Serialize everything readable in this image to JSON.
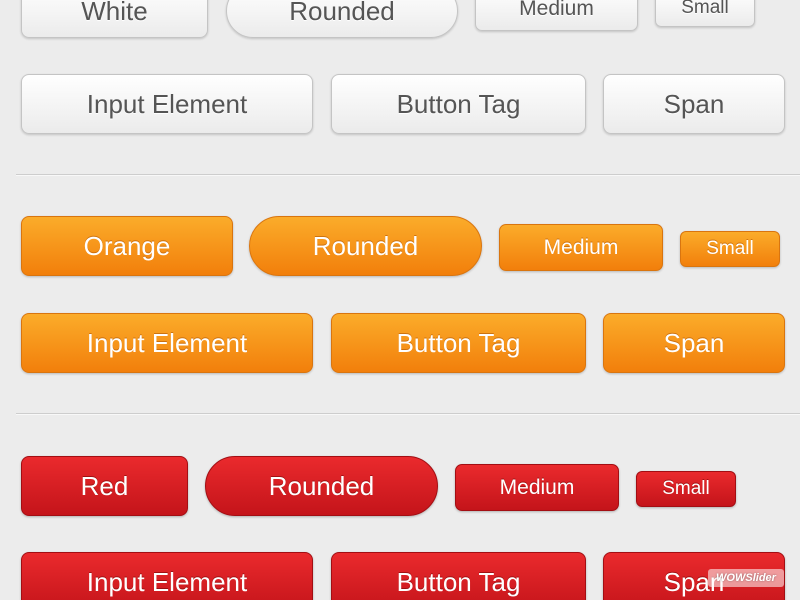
{
  "white_section": {
    "row1": [
      "White",
      "Rounded",
      "Medium",
      "Small"
    ],
    "row2": [
      "Input Element",
      "Button Tag",
      "Span"
    ]
  },
  "orange_section": {
    "row1": [
      "Orange",
      "Rounded",
      "Medium",
      "Small"
    ],
    "row2": [
      "Input Element",
      "Button Tag",
      "Span"
    ]
  },
  "red_section": {
    "row1": [
      "Red",
      "Rounded",
      "Medium",
      "Small"
    ],
    "row2": [
      "Input Element",
      "Button Tag",
      "Span"
    ]
  },
  "watermark": "WOWSlider",
  "colors": {
    "background": "#ececec",
    "white_text": "#555555",
    "orange": "#f7921c",
    "red": "#d61c20"
  }
}
